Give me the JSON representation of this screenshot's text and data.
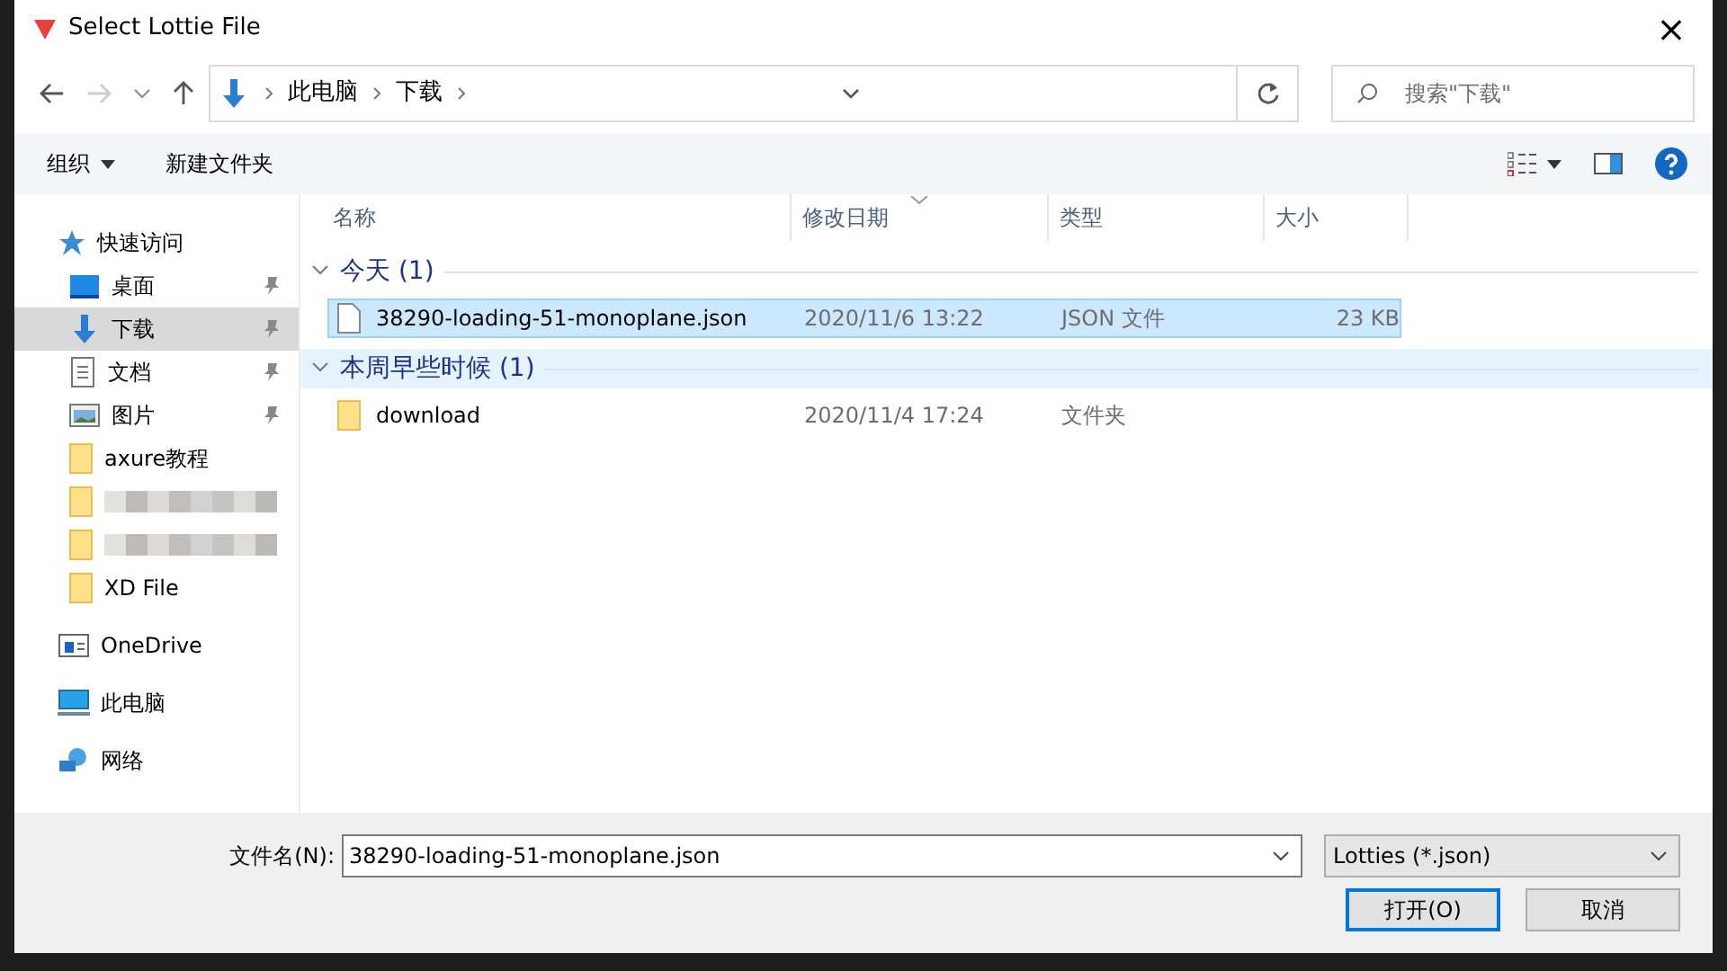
{
  "window": {
    "title": "Select Lottie File",
    "close": "×"
  },
  "address": {
    "crumbs": [
      "此电脑",
      "下载"
    ],
    "search_placeholder": "搜索\"下载\""
  },
  "toolbar": {
    "organize": "组织",
    "new_folder": "新建文件夹"
  },
  "sidebar": {
    "items": [
      {
        "label": "快速访问",
        "kind": "star",
        "selected": false,
        "pinned": false,
        "children": [
          {
            "label": "桌面",
            "kind": "desktop",
            "selected": false,
            "pinned": true
          },
          {
            "label": "下载",
            "kind": "download",
            "selected": true,
            "pinned": true
          },
          {
            "label": "文档",
            "kind": "document",
            "selected": false,
            "pinned": true
          },
          {
            "label": "图片",
            "kind": "pictures",
            "selected": false,
            "pinned": true
          },
          {
            "label": "axure教程",
            "kind": "folder",
            "selected": false,
            "pinned": false
          },
          {
            "kind": "blurred",
            "selected": false,
            "pinned": false
          },
          {
            "kind": "blurred",
            "selected": false,
            "pinned": false
          },
          {
            "label": "XD File",
            "kind": "folder",
            "selected": false,
            "pinned": false
          }
        ]
      },
      {
        "label": "OneDrive",
        "kind": "cloud",
        "selected": false,
        "pinned": false
      },
      {
        "label": "此电脑",
        "kind": "computer",
        "selected": false,
        "pinned": false
      },
      {
        "label": "网络",
        "kind": "network",
        "selected": false,
        "pinned": false
      }
    ]
  },
  "table": {
    "columns": [
      {
        "label": "名称",
        "sorted": false
      },
      {
        "label": "修改日期",
        "sorted": true
      },
      {
        "label": "类型",
        "sorted": false
      },
      {
        "label": "大小",
        "sorted": false
      }
    ],
    "groups": [
      {
        "title": "今天 (1)",
        "expanded": true,
        "hovered": false,
        "rows": [
          {
            "name": "38290-loading-51-monoplane.json",
            "date": "2020/11/6 13:22",
            "type": "JSON 文件",
            "size": "23 KB",
            "kind": "file",
            "selected": true
          }
        ]
      },
      {
        "title": "本周早些时候 (1)",
        "expanded": true,
        "hovered": true,
        "rows": [
          {
            "name": "download",
            "date": "2020/11/4 17:24",
            "type": "文件夹",
            "kind": "folder",
            "selected": false
          }
        ]
      }
    ]
  },
  "footer": {
    "filename_label": "文件名(N):",
    "filename": "38290-loading-51-monoplane.json",
    "filter": "Lotties (*.json)",
    "buttons": [
      {
        "label": "打开(O)",
        "default": true
      },
      {
        "label": "取消",
        "default": false
      }
    ]
  }
}
